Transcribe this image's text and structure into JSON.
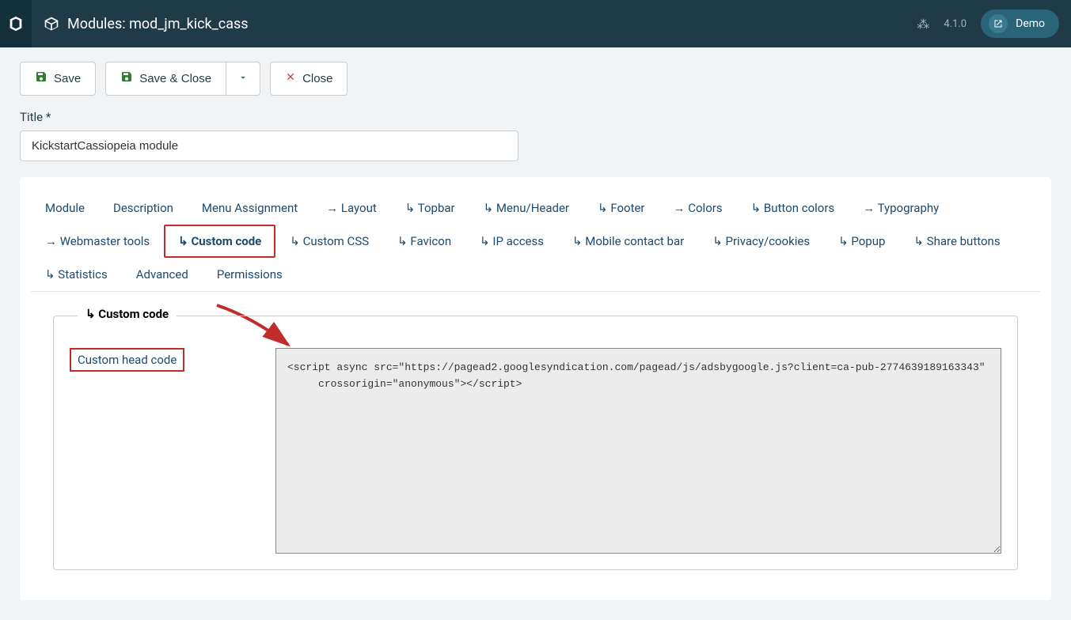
{
  "header": {
    "title": "Modules: mod_jm_kick_cass",
    "version": "4.1.0",
    "demo_label": "Demo"
  },
  "toolbar": {
    "save": "Save",
    "save_close": "Save & Close",
    "close": "Close"
  },
  "form": {
    "title_label": "Title *",
    "title_value": "KickstartCassiopeia module"
  },
  "tabs": [
    {
      "label": "Module",
      "prefix": ""
    },
    {
      "label": "Description",
      "prefix": ""
    },
    {
      "label": "Menu Assignment",
      "prefix": ""
    },
    {
      "label": "Layout",
      "prefix": "→ "
    },
    {
      "label": "Topbar",
      "prefix": "↳ "
    },
    {
      "label": "Menu/Header",
      "prefix": "↳ "
    },
    {
      "label": "Footer",
      "prefix": "↳ "
    },
    {
      "label": "Colors",
      "prefix": "→ "
    },
    {
      "label": "Button colors",
      "prefix": "↳ "
    },
    {
      "label": "Typography",
      "prefix": "→ "
    },
    {
      "label": "Webmaster tools",
      "prefix": "→ "
    },
    {
      "label": "Custom code",
      "prefix": "↳ ",
      "active": true
    },
    {
      "label": "Custom CSS",
      "prefix": "↳ "
    },
    {
      "label": "Favicon",
      "prefix": "↳ "
    },
    {
      "label": "IP access",
      "prefix": "↳ "
    },
    {
      "label": "Mobile contact bar",
      "prefix": "↳ "
    },
    {
      "label": "Privacy/cookies",
      "prefix": "↳ "
    },
    {
      "label": "Popup",
      "prefix": "↳ "
    },
    {
      "label": "Share buttons",
      "prefix": "↳ "
    },
    {
      "label": "Statistics",
      "prefix": "↳ "
    },
    {
      "label": "Advanced",
      "prefix": ""
    },
    {
      "label": "Permissions",
      "prefix": ""
    }
  ],
  "fieldset": {
    "legend": "↳ Custom code",
    "field_label": "Custom head code",
    "textarea_value": "<script async src=\"https://pagead2.googlesyndication.com/pagead/js/adsbygoogle.js?client=ca-pub-2774639189163343\"\n     crossorigin=\"anonymous\"></script>"
  }
}
